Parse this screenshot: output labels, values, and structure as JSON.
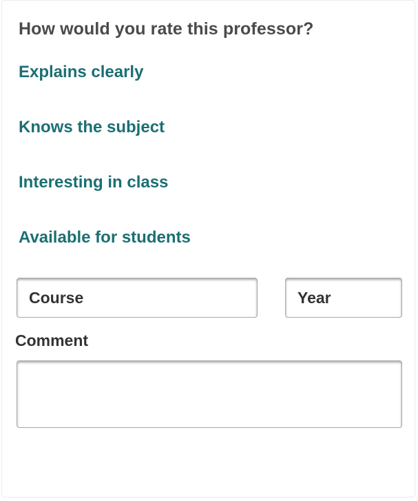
{
  "form": {
    "question": "How would you rate this professor?",
    "criteria": [
      {
        "label": "Explains clearly"
      },
      {
        "label": "Knows the subject"
      },
      {
        "label": "Interesting in class"
      },
      {
        "label": "Available for students"
      }
    ],
    "course": {
      "placeholder": "Course",
      "value": ""
    },
    "year": {
      "placeholder": "Year",
      "value": ""
    },
    "comment": {
      "label": "Comment",
      "value": ""
    }
  },
  "colors": {
    "accent": "#1b6f73",
    "heading": "#4a4a4a",
    "text": "#333333",
    "border": "#a9a9a9"
  }
}
